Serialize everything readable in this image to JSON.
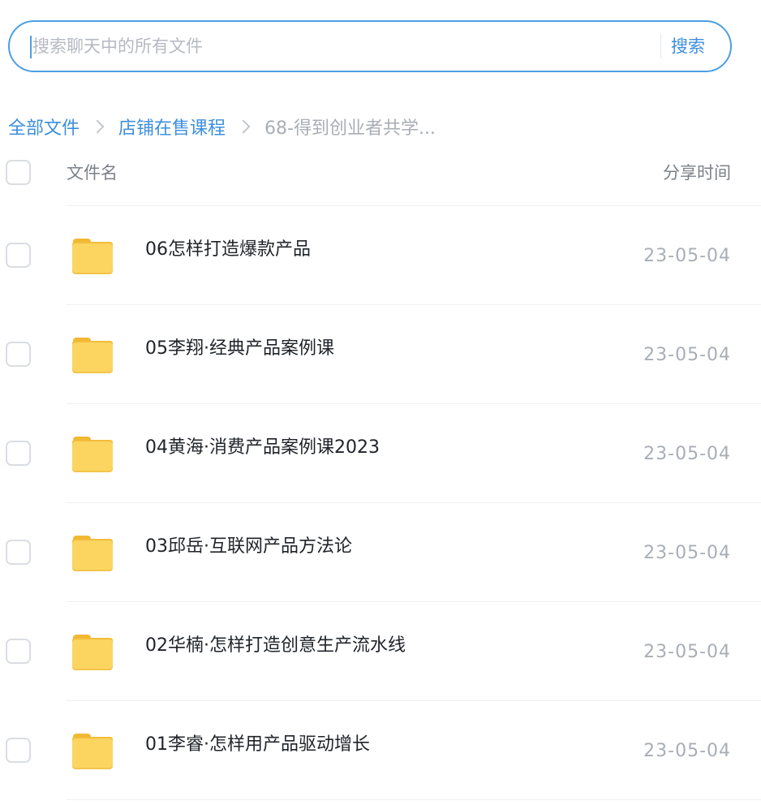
{
  "search": {
    "placeholder": "搜索聊天中的所有文件",
    "value": "",
    "button_label": "搜索"
  },
  "breadcrumb": {
    "items": [
      "全部文件",
      "店铺在售课程"
    ],
    "current": "68-得到创业者共学..."
  },
  "table": {
    "columns": {
      "name": "文件名",
      "time": "分享时间"
    },
    "rows": [
      {
        "name": "06怎样打造爆款产品",
        "date": "23-05-04",
        "icon": "folder-icon"
      },
      {
        "name": "05李翔·经典产品案例课",
        "date": "23-05-04",
        "icon": "folder-icon"
      },
      {
        "name": "04黄海·消费产品案例课2023",
        "date": "23-05-04",
        "icon": "folder-icon"
      },
      {
        "name": "03邱岳·互联网产品方法论",
        "date": "23-05-04",
        "icon": "folder-icon"
      },
      {
        "name": "02华楠·怎样打造创意生产流水线",
        "date": "23-05-04",
        "icon": "folder-icon"
      },
      {
        "name": "01李睿·怎样用产品驱动增长",
        "date": "23-05-04",
        "icon": "folder-icon"
      }
    ]
  },
  "colors": {
    "accent": "#3d8fdc",
    "muted_text": "#a9aeb6",
    "folder": "#fbd560"
  }
}
